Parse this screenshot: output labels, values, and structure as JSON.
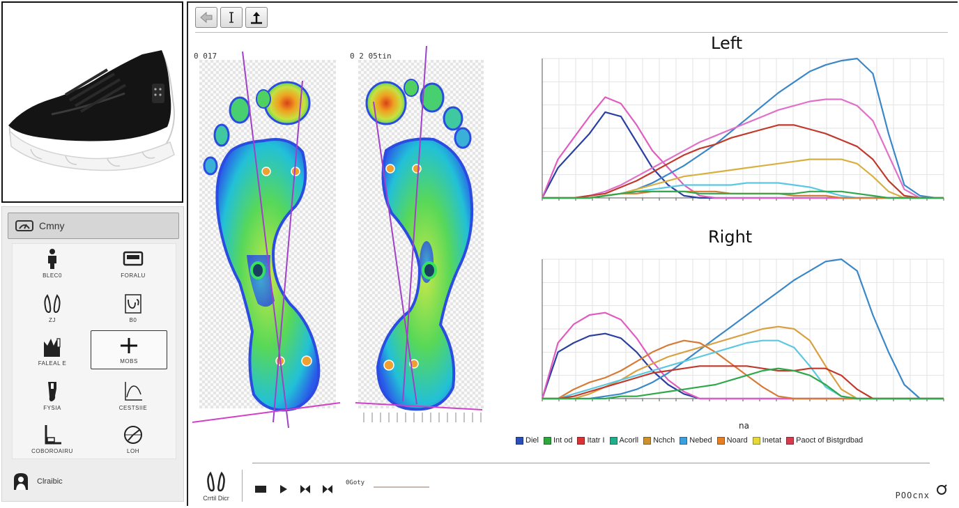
{
  "sidebar": {
    "header_label": "Cmny",
    "tools": [
      {
        "label": "BLEC0",
        "icon": "figure-icon"
      },
      {
        "label": "FORALU",
        "icon": "platform-icon"
      },
      {
        "label": "ZJ",
        "icon": "feet-icon"
      },
      {
        "label": "B0",
        "icon": "foot-outline-icon"
      },
      {
        "label": "FALEAL E",
        "icon": "pressure-bars-icon"
      },
      {
        "label": "MOBS",
        "icon": "add-icon"
      },
      {
        "label": "FYSIA",
        "icon": "leg-icon"
      },
      {
        "label": "CESTSIIE",
        "icon": "curve-icon"
      },
      {
        "label": "COBOROAIRU",
        "icon": "corner-icon"
      },
      {
        "label": "LOH",
        "icon": "gauge-icon"
      }
    ],
    "footer_label": "Clraibic"
  },
  "foot_maps": {
    "left_label": "0 017",
    "right_label": "0 2 05tin"
  },
  "charts": {
    "left_title": "Left",
    "right_title": "Right",
    "x_unit": "na"
  },
  "legend": [
    {
      "label": "Diel",
      "color": "#2a4fb8"
    },
    {
      "label": "Int od",
      "color": "#2ea83a"
    },
    {
      "label": "Itatr I",
      "color": "#d93333"
    },
    {
      "label": "Acorll",
      "color": "#1fb08a"
    },
    {
      "label": "Nchch",
      "color": "#cf9030"
    },
    {
      "label": "Nebed",
      "color": "#3aa0e0"
    },
    {
      "label": "Noard",
      "color": "#e67e22"
    },
    {
      "label": "Inetat",
      "color": "#e6d83a"
    },
    {
      "label": "Paoct of Bistgrdbad",
      "color": "#d63b4e"
    }
  ],
  "playback": {
    "feet_label": "Crrtil Dicr",
    "time": "0Goty",
    "right_text": "POOcnx"
  },
  "colors": {
    "panel_bg": "#ededed",
    "pink": "#e05cc0",
    "navy": "#2a3fa0",
    "blue": "#3a87c8",
    "red": "#c0392b",
    "orange": "#d77a35",
    "gold": "#d8b040",
    "cyan": "#5ac8e0",
    "green": "#2ea84a"
  },
  "chart_data": [
    {
      "type": "line",
      "title": "Left",
      "xlabel": "",
      "ylabel": "",
      "xlim": [
        0,
        1020
      ],
      "ylim": [
        0,
        65
      ],
      "x": [
        0,
        40,
        80,
        120,
        160,
        200,
        240,
        280,
        320,
        360,
        400,
        440,
        480,
        520,
        560,
        600,
        640,
        680,
        720,
        760,
        800,
        840,
        880,
        920,
        960,
        1000,
        1020
      ],
      "series": [
        {
          "color": "#2a3fa0",
          "values": [
            0,
            14,
            22,
            30,
            40,
            38,
            26,
            14,
            6,
            1,
            0,
            0,
            0,
            0,
            0,
            0,
            0,
            0,
            0,
            0,
            0,
            0,
            0,
            0,
            0,
            0,
            0
          ]
        },
        {
          "color": "#e05cc0",
          "values": [
            0,
            18,
            28,
            38,
            47,
            44,
            34,
            22,
            14,
            6,
            1,
            0,
            0,
            0,
            0,
            0,
            0,
            0,
            0,
            0,
            0,
            0,
            0,
            0,
            0,
            0,
            0
          ]
        },
        {
          "color": "#3a87c8",
          "values": [
            0,
            0,
            0,
            0,
            1,
            2,
            4,
            7,
            11,
            15,
            20,
            25,
            31,
            37,
            43,
            49,
            54,
            59,
            62,
            64,
            65,
            58,
            30,
            6,
            1,
            0,
            0
          ]
        },
        {
          "color": "#e070c8",
          "values": [
            0,
            0,
            0,
            1,
            3,
            6,
            10,
            14,
            18,
            22,
            26,
            29,
            32,
            35,
            38,
            41,
            43,
            45,
            46,
            46,
            43,
            36,
            20,
            4,
            0,
            0,
            0
          ]
        },
        {
          "color": "#c0392b",
          "values": [
            0,
            0,
            0,
            1,
            2,
            5,
            8,
            12,
            16,
            20,
            23,
            25,
            28,
            30,
            32,
            34,
            34,
            32,
            30,
            27,
            24,
            18,
            8,
            1,
            0,
            0,
            0
          ]
        },
        {
          "color": "#d8b040",
          "values": [
            0,
            0,
            0,
            0,
            1,
            2,
            4,
            6,
            8,
            10,
            11,
            12,
            13,
            14,
            15,
            16,
            17,
            18,
            18,
            18,
            16,
            10,
            3,
            0,
            0,
            0,
            0
          ]
        },
        {
          "color": "#5ac8e0",
          "values": [
            0,
            0,
            0,
            0,
            1,
            2,
            3,
            4,
            5,
            6,
            6,
            6,
            6,
            7,
            7,
            7,
            6,
            5,
            3,
            1,
            0,
            0,
            0,
            0,
            0,
            0,
            0
          ]
        },
        {
          "color": "#d77a35",
          "values": [
            0,
            0,
            0,
            0,
            1,
            2,
            2,
            3,
            3,
            3,
            3,
            3,
            2,
            2,
            2,
            2,
            1,
            1,
            1,
            0,
            0,
            0,
            0,
            0,
            0,
            0,
            0
          ]
        },
        {
          "color": "#2ea84a",
          "values": [
            0,
            0,
            0,
            0,
            1,
            2,
            3,
            3,
            3,
            3,
            2,
            2,
            2,
            2,
            2,
            2,
            2,
            3,
            3,
            3,
            2,
            1,
            0,
            0,
            0,
            0,
            0
          ]
        }
      ]
    },
    {
      "type": "line",
      "title": "Right",
      "xlabel": "na",
      "ylabel": "",
      "xlim": [
        0,
        1020
      ],
      "ylim": [
        0,
        60
      ],
      "x": [
        0,
        40,
        80,
        120,
        160,
        200,
        240,
        280,
        320,
        360,
        400,
        440,
        480,
        520,
        560,
        600,
        640,
        680,
        720,
        760,
        800,
        840,
        880,
        920,
        960,
        1000,
        1020
      ],
      "series": [
        {
          "color": "#2a3fa0",
          "values": [
            0,
            20,
            24,
            27,
            28,
            26,
            20,
            12,
            6,
            2,
            0,
            0,
            0,
            0,
            0,
            0,
            0,
            0,
            0,
            0,
            0,
            0,
            0,
            0,
            0,
            0,
            0
          ]
        },
        {
          "color": "#e05cc0",
          "values": [
            0,
            24,
            32,
            36,
            37,
            34,
            26,
            16,
            8,
            3,
            0,
            0,
            0,
            0,
            0,
            0,
            0,
            0,
            0,
            0,
            0,
            0,
            0,
            0,
            0,
            0,
            0
          ]
        },
        {
          "color": "#3a87c8",
          "values": [
            0,
            0,
            0,
            0,
            1,
            2,
            4,
            7,
            11,
            16,
            21,
            26,
            31,
            36,
            41,
            46,
            51,
            55,
            59,
            60,
            55,
            36,
            20,
            6,
            0,
            0,
            0
          ]
        },
        {
          "color": "#d8a040",
          "values": [
            0,
            0,
            0,
            2,
            5,
            8,
            12,
            15,
            18,
            20,
            22,
            24,
            26,
            28,
            30,
            31,
            30,
            25,
            14,
            4,
            0,
            0,
            0,
            0,
            0,
            0,
            0
          ]
        },
        {
          "color": "#d77a35",
          "values": [
            0,
            0,
            4,
            7,
            9,
            12,
            16,
            20,
            23,
            25,
            24,
            20,
            15,
            10,
            5,
            1,
            0,
            0,
            0,
            0,
            0,
            0,
            0,
            0,
            0,
            0,
            0
          ]
        },
        {
          "color": "#5ac8e0",
          "values": [
            0,
            0,
            2,
            4,
            6,
            8,
            10,
            12,
            14,
            16,
            18,
            20,
            22,
            24,
            25,
            25,
            22,
            14,
            5,
            1,
            0,
            0,
            0,
            0,
            0,
            0,
            0
          ]
        },
        {
          "color": "#c0392b",
          "values": [
            0,
            0,
            1,
            3,
            5,
            7,
            9,
            11,
            12,
            13,
            14,
            14,
            14,
            14,
            13,
            12,
            12,
            13,
            13,
            10,
            4,
            0,
            0,
            0,
            0,
            0,
            0
          ]
        },
        {
          "color": "#2ea84a",
          "values": [
            0,
            0,
            0,
            0,
            0,
            1,
            1,
            2,
            3,
            4,
            5,
            6,
            8,
            10,
            12,
            13,
            12,
            10,
            6,
            1,
            0,
            0,
            0,
            0,
            0,
            0,
            0
          ]
        }
      ]
    }
  ]
}
